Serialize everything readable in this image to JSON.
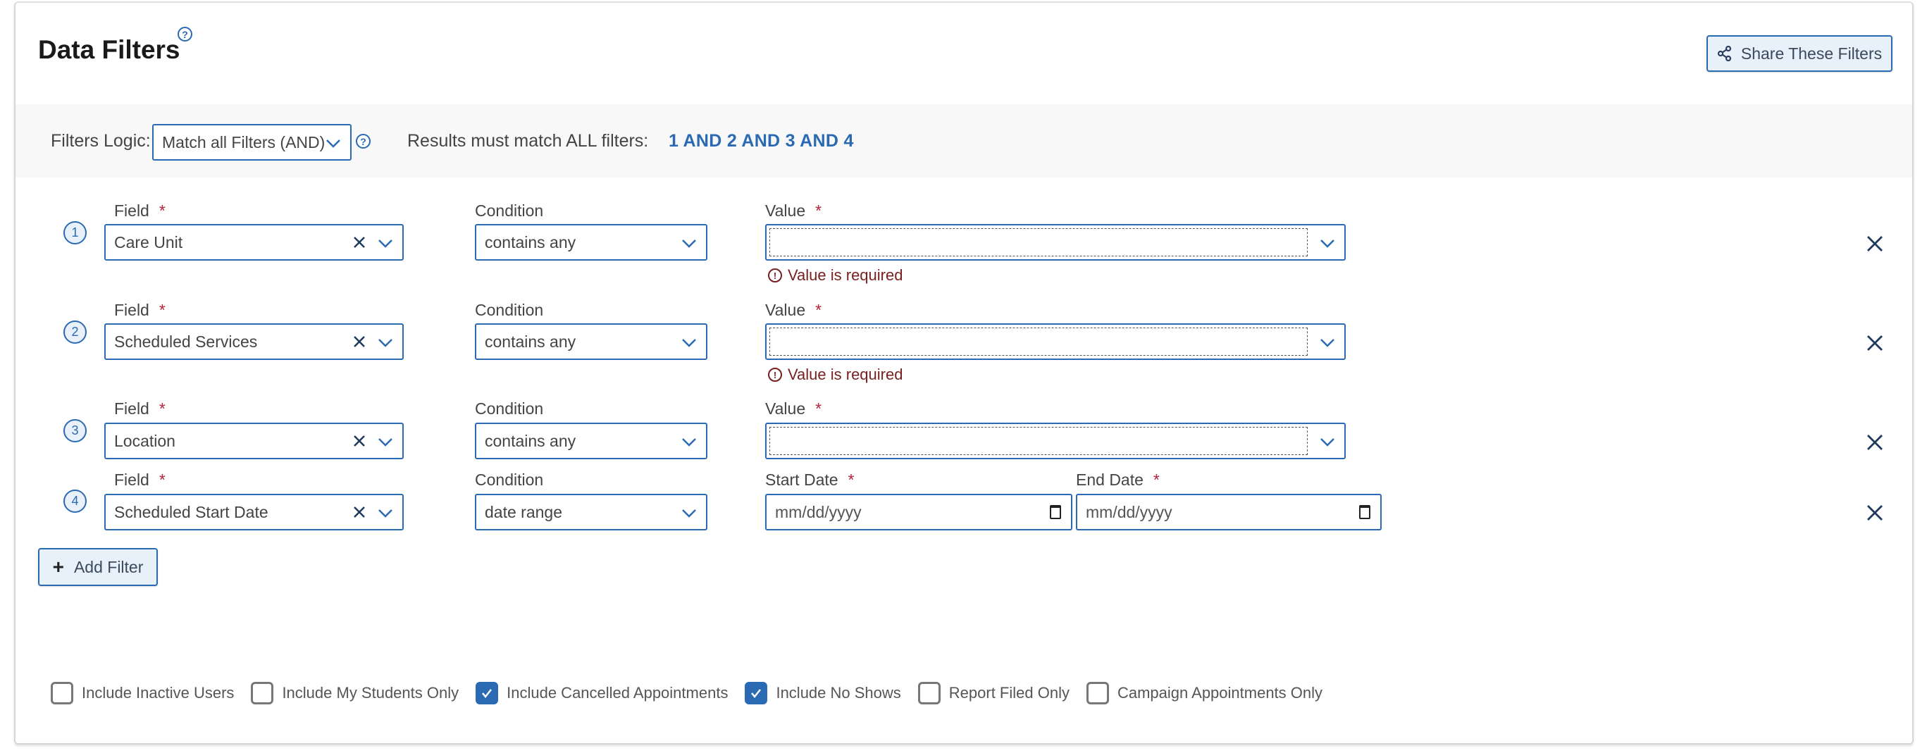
{
  "header": {
    "title": "Data Filters",
    "help_icon": "question-circle-icon",
    "share_button": {
      "label": "Share These Filters",
      "icon": "share-icon"
    }
  },
  "logic": {
    "label": "Filters Logic:",
    "selected": "Match all Filters (AND)",
    "results_label": "Results must match ALL filters:",
    "results_value": "1 AND 2 AND 3 AND 4"
  },
  "filters": [
    {
      "number": "1",
      "field_label": "Field",
      "field_value": "Care Unit",
      "condition_label": "Condition",
      "condition_value": "contains any",
      "value_label": "Value",
      "value": "",
      "error": "Value is required"
    },
    {
      "number": "2",
      "field_label": "Field",
      "field_value": "Scheduled Services",
      "condition_label": "Condition",
      "condition_value": "contains any",
      "value_label": "Value",
      "value": "",
      "error": "Value is required"
    },
    {
      "number": "3",
      "field_label": "Field",
      "field_value": "Location",
      "condition_label": "Condition",
      "condition_value": "contains any",
      "value_label": "Value",
      "value": ""
    },
    {
      "number": "4",
      "field_label": "Field",
      "field_value": "Scheduled Start Date",
      "condition_label": "Condition",
      "condition_value": "date range",
      "start_label": "Start Date",
      "start_placeholder": "mm/dd/yyyy",
      "end_label": "End Date",
      "end_placeholder": "mm/dd/yyyy"
    }
  ],
  "required_marker": "*",
  "add_filter": {
    "label": "Add Filter",
    "icon": "plus-icon"
  },
  "options": [
    {
      "label": "Include Inactive Users",
      "checked": false
    },
    {
      "label": "Include My Students Only",
      "checked": false
    },
    {
      "label": "Include Cancelled Appointments",
      "checked": true
    },
    {
      "label": "Include No Shows",
      "checked": true
    },
    {
      "label": "Report Filed Only",
      "checked": false
    },
    {
      "label": "Campaign Appointments Only",
      "checked": false
    }
  ],
  "colors": {
    "accent": "#2a6ab3",
    "error": "#7a1f1f",
    "required": "#b0253a",
    "button_bg": "#e8f0fa",
    "bar_bg": "#f8f8f8"
  }
}
